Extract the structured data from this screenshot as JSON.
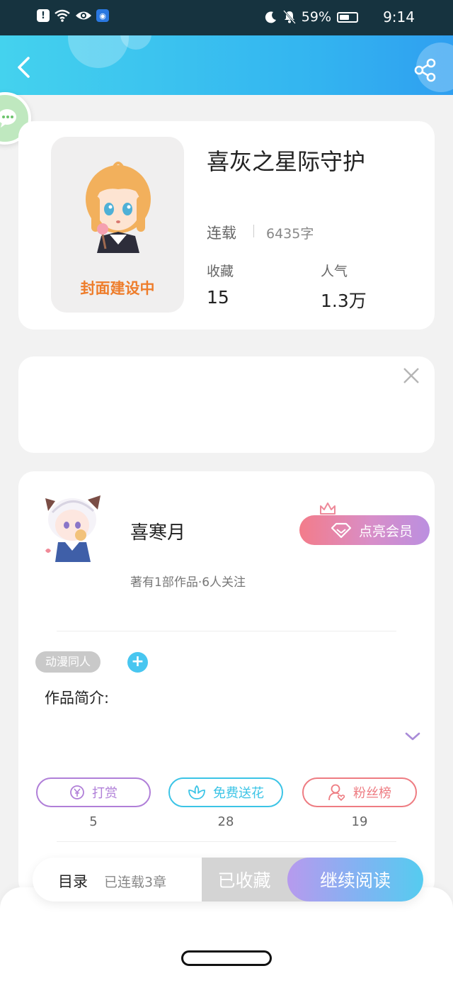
{
  "status_bar": {
    "battery": "59%",
    "battery_level": 0.59,
    "time": "9:14",
    "icons": [
      "alert-icon",
      "wifi-icon",
      "eye-icon",
      "bulb-icon",
      "moon-icon",
      "bell-off-icon",
      "battery-icon"
    ]
  },
  "header": {
    "back_icon": "chevron-left-icon",
    "share_icon": "share-icon"
  },
  "float": {
    "icon": "wechat-icon"
  },
  "book": {
    "cover_text": "封面建设中",
    "title": "喜灰之星际守护",
    "status": "连载",
    "word_count": "6435字",
    "stats": [
      {
        "label": "收藏",
        "value": "15"
      },
      {
        "label": "人气",
        "value": "1.3万"
      }
    ]
  },
  "ad": {
    "close_icon": "close-icon"
  },
  "author": {
    "name": "喜寒月",
    "meta": "著有1部作品·6人关注",
    "vip_label": "点亮会员",
    "tag": "动漫同人",
    "tag_add": "+",
    "intro_label": "作品简介:"
  },
  "actions": [
    {
      "label": "打赏",
      "count": "5",
      "color": "#b07fd8",
      "icon": "yen-coin-icon"
    },
    {
      "label": "免费送花",
      "count": "28",
      "color": "#3cc4e6",
      "icon": "flower-icon"
    },
    {
      "label": "粉丝榜",
      "count": "19",
      "color": "#ee7c82",
      "icon": "fan-user-icon"
    }
  ],
  "bottom_bar": {
    "toc_label": "目录",
    "toc_count": "已连载3章",
    "collected_label": "已收藏",
    "read_label": "继续阅读"
  }
}
